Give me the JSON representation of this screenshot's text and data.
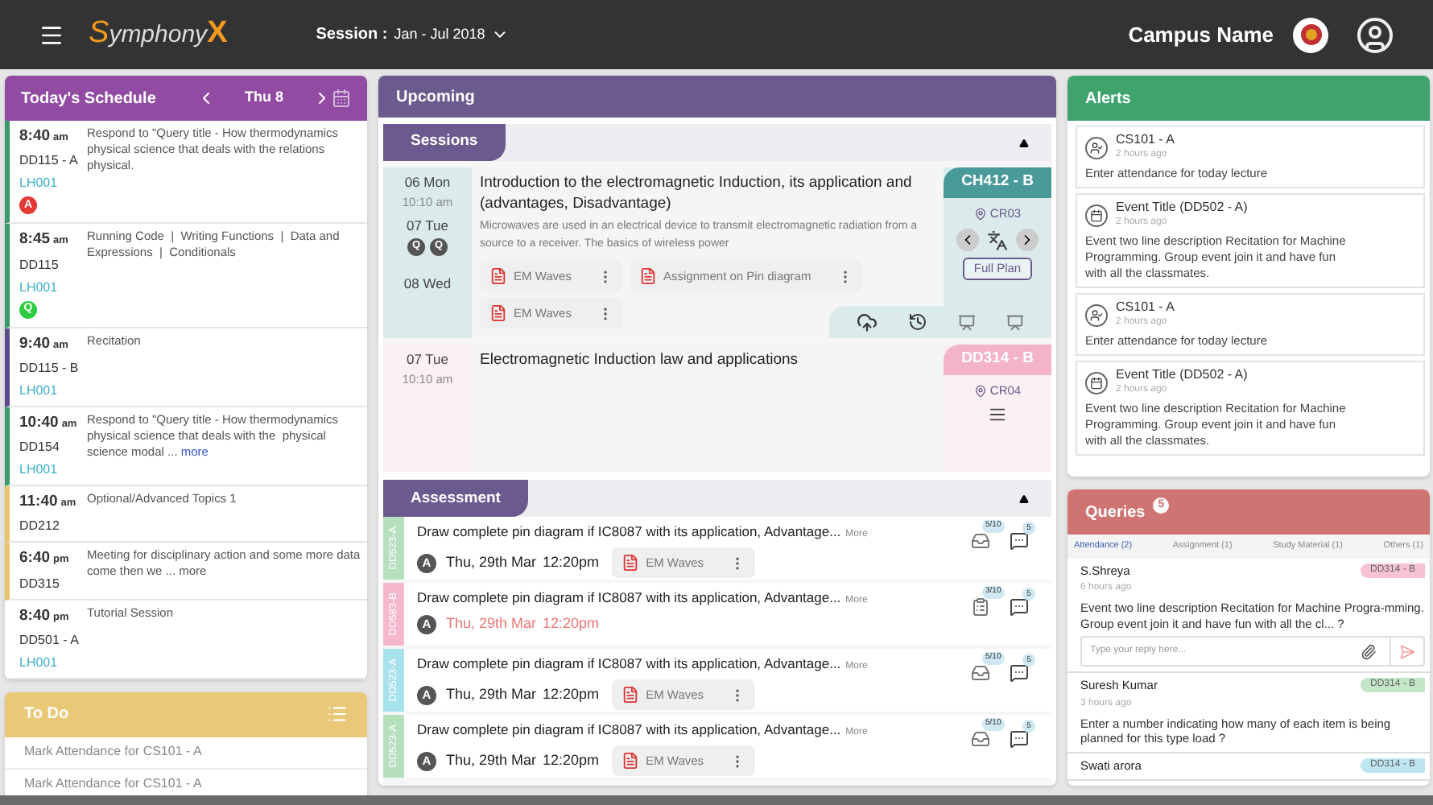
{
  "header": {
    "logo_text": "Symphony",
    "logo_mark": "X",
    "session_label": "Session :",
    "session_value": "Jan - Jul 2018",
    "campus_name": "Campus Name"
  },
  "schedule": {
    "title": "Today's Schedule",
    "date": "Thu 8",
    "items": [
      {
        "time": "8:40",
        "meridiem": "am",
        "code": "DD115 - A",
        "room": "LH001",
        "text": "Respond to \"Query title - How thermodynamics physical science that deals with the relations physical.",
        "color": "#3a9a6a",
        "badge": {
          "text": "A",
          "color": "#e53935"
        }
      },
      {
        "time": "8:45",
        "meridiem": "am",
        "code": "DD115",
        "room": "LH001",
        "text": "Running Code  |  Writing Functions  |  Data and Expressions  |  Conditionals",
        "color": "#3a9a6a",
        "badge": {
          "text": "Q",
          "color": "#2ecc40"
        }
      },
      {
        "time": "9:40",
        "meridiem": "am",
        "code": "DD115 - B",
        "room": "LH001",
        "text": "Recitation",
        "color": "#5a4a8a"
      },
      {
        "time": "10:40",
        "meridiem": "am",
        "code": "DD154",
        "room": "LH001",
        "text": "Respond to \"Query title - How thermodynamics physical science that deals with the  physical science modal ...",
        "more": "more",
        "color": "#3a9a6a"
      },
      {
        "time": "11:40",
        "meridiem": "am",
        "code": "DD212",
        "text": "Optional/Advanced Topics 1",
        "color": "#e8c46a"
      },
      {
        "time": "6:40",
        "meridiem": "pm",
        "code": "DD315",
        "text": "Meeting for disciplinary action and some more data come then we ...",
        "more": "more",
        "color": "#e8c46a"
      },
      {
        "time": "8:40",
        "meridiem": "pm",
        "code": "DD501 - A",
        "room": "LH001",
        "text": "Tutorial Session"
      }
    ]
  },
  "todo": {
    "title": "To Do",
    "items": [
      "Mark Attendance for CS101 - A",
      "Mark Attendance for CS101 - A"
    ]
  },
  "upcoming": {
    "title": "Upcoming",
    "sessions": {
      "title": "Sessions",
      "items": [
        {
          "dates": [
            {
              "day": "06 Mon",
              "time": "10:10 am"
            },
            {
              "day": "07 Tue",
              "badges": [
                "Q",
                "Q"
              ]
            },
            {
              "day": "08 Wed"
            }
          ],
          "title": "Introduction to the electromagnetic Induction, its application and (advantages, Disadvantage)",
          "description": "Microwaves are used in an electrical device to transmit electromagnetic radiation from a source to a receiver. The basics of wireless power",
          "files": [
            "EM Waves",
            "Assignment on Pin diagram",
            "EM Waves"
          ],
          "course": "CH412 - B",
          "color": "#4a9a9a",
          "room": "CR03",
          "button": "Full Plan"
        },
        {
          "dates": [
            {
              "day": "07 Tue",
              "time": "10:10 am"
            }
          ],
          "title": "Electromagnetic Induction law and applications",
          "course": "DD314 - B",
          "color": "#f4b4c8",
          "room": "CR04"
        }
      ]
    },
    "assessment": {
      "title": "Assessment",
      "items": [
        {
          "course": "DD523-A",
          "color": "#b6dfbe",
          "title": "Draw complete pin diagram if IC8087 with its application, Advantage...",
          "more": "More",
          "badge": "A",
          "date": "Thu, 29th Mar",
          "time": "12:20pm",
          "overdue": false,
          "file": "EM Waves",
          "submissions": "5/10",
          "queries": "5"
        },
        {
          "course": "DD583-B",
          "color": "#f5b8cb",
          "title": "Draw complete pin diagram if IC8087 with its application, Advantage...",
          "more": "More",
          "badge": "A",
          "date": "Thu, 29th Mar",
          "time": "12:20pm",
          "overdue": true,
          "submissions": "3/10",
          "queries": "5"
        },
        {
          "course": "DD523-A",
          "color": "#a8e2ec",
          "title": "Draw complete pin diagram if IC8087 with its application, Advantage...",
          "more": "More",
          "badge": "A",
          "date": "Thu, 29th Mar",
          "time": "12:20pm",
          "overdue": false,
          "file": "EM Waves",
          "submissions": "5/10",
          "queries": "5"
        },
        {
          "course": "DD523-A",
          "color": "#b6dfbe",
          "title": "Draw complete pin diagram if IC8087 with its application, Advantage...",
          "more": "More",
          "badge": "A",
          "date": "Thu, 29th Mar",
          "time": "12:20pm",
          "overdue": false,
          "file": "EM Waves",
          "submissions": "5/10",
          "queries": "5"
        }
      ]
    }
  },
  "alerts": {
    "title": "Alerts",
    "items": [
      {
        "kind": "attendance",
        "title": "CS101 - A",
        "time": "2 hours ago",
        "text": "Enter attendance for today lecture"
      },
      {
        "kind": "event",
        "title": "Event Title (DD502 - A)",
        "time": "2 hours ago",
        "text": "Event two line description Recitation for Machine Programming. Group event join it and have fun with all the classmates."
      },
      {
        "kind": "attendance",
        "title": "CS101 - A",
        "time": "2 hours ago",
        "text": "Enter attendance for today lecture"
      },
      {
        "kind": "event",
        "title": "Event Title (DD502 - A)",
        "time": "2 hours ago",
        "text": "Event two line description Recitation for Machine Programming. Group event join it and have fun with all the classmates."
      }
    ]
  },
  "queries": {
    "title": "Queries",
    "count": "5",
    "tabs": [
      {
        "label": "Attendance (2)",
        "selected": true
      },
      {
        "label": "Assignment (1)",
        "selected": false
      },
      {
        "label": "Study Material (1)",
        "selected": false
      },
      {
        "label": "Others (1)",
        "selected": false
      }
    ],
    "items": [
      {
        "name": "S.Shreya",
        "time": "6 hours ago",
        "text": "Event two line description Recitation for Machine Progra-mming. Group event join it and have fun with all the cl... ?",
        "course": "DD314 - B",
        "color": "#f7c3d4",
        "reply_placeholder": "Type your reply here..."
      },
      {
        "name": "Suresh Kumar",
        "time": "3 hours ago",
        "text": "Enter a number indicating how many of each item is being planned for this type load ?",
        "course": "DD314 - B",
        "color": "#c3e6c7"
      },
      {
        "name": "Swati arora",
        "course": "DD314 - B",
        "color": "#bde6f2"
      }
    ]
  }
}
